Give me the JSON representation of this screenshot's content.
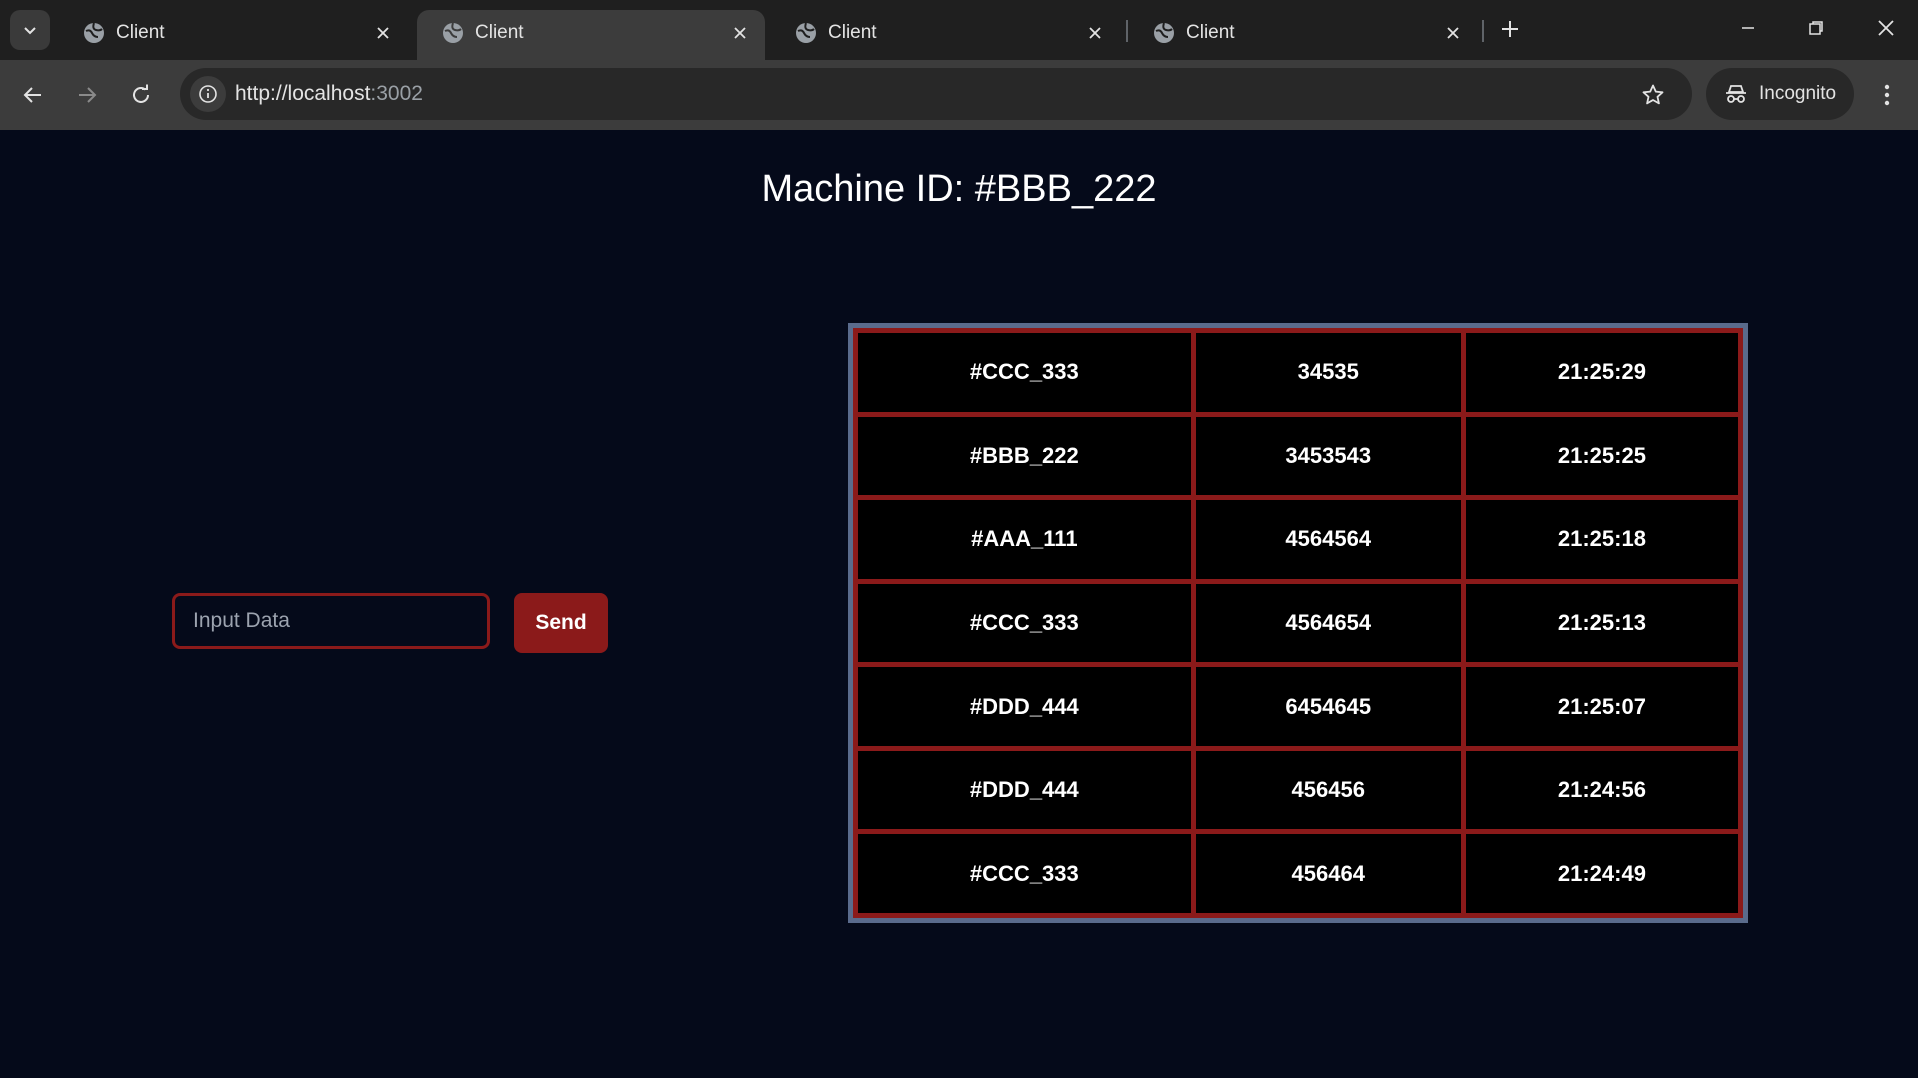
{
  "browser": {
    "tabs": [
      {
        "title": "Client",
        "active": false
      },
      {
        "title": "Client",
        "active": true
      },
      {
        "title": "Client",
        "active": false
      },
      {
        "title": "Client",
        "active": false
      }
    ],
    "url_host": "http://localhost",
    "url_port": ":3002",
    "incognito_label": "Incognito"
  },
  "page": {
    "heading": "Machine ID: #BBB_222",
    "input_placeholder": "Input Data",
    "send_label": "Send"
  },
  "table": {
    "rows": [
      {
        "machine": "#CCC_333",
        "value": "34535",
        "time": "21:25:29"
      },
      {
        "machine": "#BBB_222",
        "value": "3453543",
        "time": "21:25:25"
      },
      {
        "machine": "#AAA_111",
        "value": "4564564",
        "time": "21:25:18"
      },
      {
        "machine": "#CCC_333",
        "value": "4564654",
        "time": "21:25:13"
      },
      {
        "machine": "#DDD_444",
        "value": "6454645",
        "time": "21:25:07"
      },
      {
        "machine": "#DDD_444",
        "value": "456456",
        "time": "21:24:56"
      },
      {
        "machine": "#CCC_333",
        "value": "456464",
        "time": "21:24:49"
      }
    ]
  },
  "colors": {
    "page_bg": "#050a1a",
    "accent": "#8b1a1a",
    "table_frame": "#5a6b8c"
  }
}
